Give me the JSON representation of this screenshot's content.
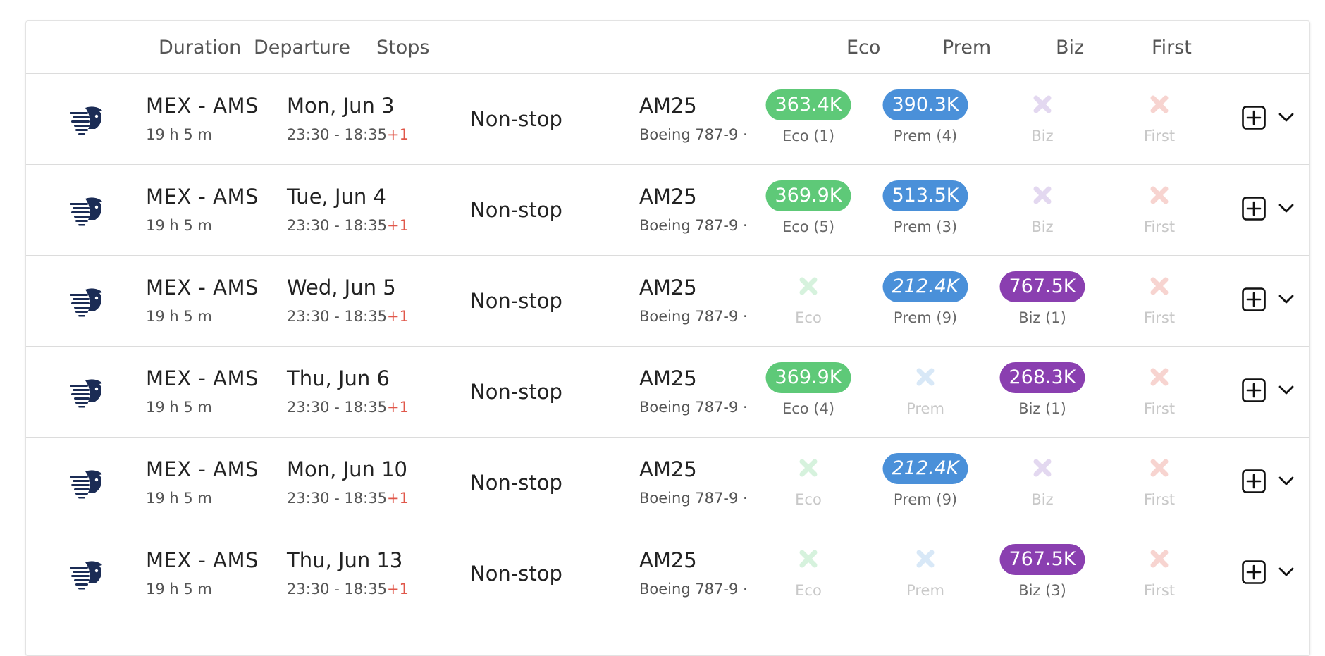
{
  "table": {
    "headers": {
      "duration": "Duration",
      "departure": "Departure",
      "stops": "Stops",
      "eco": "Eco",
      "prem": "Prem",
      "biz": "Biz",
      "first": "First"
    },
    "rows": [
      {
        "route": "MEX - AMS",
        "duration": "19 h 5 m",
        "date": "Mon, Jun 3",
        "times": "23:30 - 18:35",
        "day_offset": "+1",
        "stops": "Non-stop",
        "flight": "AM25",
        "aircraft": "Boeing 787-9 ·",
        "eco": {
          "available": true,
          "price": "363.4K",
          "label": "Eco (1)"
        },
        "prem": {
          "available": true,
          "price": "390.3K",
          "label": "Prem (4)"
        },
        "biz": {
          "available": false,
          "label": "Biz"
        },
        "first": {
          "available": false,
          "label": "First"
        }
      },
      {
        "route": "MEX - AMS",
        "duration": "19 h 5 m",
        "date": "Tue, Jun 4",
        "times": "23:30 - 18:35",
        "day_offset": "+1",
        "stops": "Non-stop",
        "flight": "AM25",
        "aircraft": "Boeing 787-9 ·",
        "eco": {
          "available": true,
          "price": "369.9K",
          "label": "Eco (5)"
        },
        "prem": {
          "available": true,
          "price": "513.5K",
          "label": "Prem (3)"
        },
        "biz": {
          "available": false,
          "label": "Biz"
        },
        "first": {
          "available": false,
          "label": "First"
        }
      },
      {
        "route": "MEX - AMS",
        "duration": "19 h 5 m",
        "date": "Wed, Jun 5",
        "times": "23:30 - 18:35",
        "day_offset": "+1",
        "stops": "Non-stop",
        "flight": "AM25",
        "aircraft": "Boeing 787-9 ·",
        "eco": {
          "available": false,
          "label": "Eco"
        },
        "prem": {
          "available": true,
          "price": "212.4K",
          "label": "Prem (9)",
          "italic": true
        },
        "biz": {
          "available": true,
          "price": "767.5K",
          "label": "Biz (1)"
        },
        "first": {
          "available": false,
          "label": "First"
        }
      },
      {
        "route": "MEX - AMS",
        "duration": "19 h 5 m",
        "date": "Thu, Jun 6",
        "times": "23:30 - 18:35",
        "day_offset": "+1",
        "stops": "Non-stop",
        "flight": "AM25",
        "aircraft": "Boeing 787-9 ·",
        "eco": {
          "available": true,
          "price": "369.9K",
          "label": "Eco (4)"
        },
        "prem": {
          "available": false,
          "label": "Prem"
        },
        "biz": {
          "available": true,
          "price": "268.3K",
          "label": "Biz (1)"
        },
        "first": {
          "available": false,
          "label": "First"
        }
      },
      {
        "route": "MEX - AMS",
        "duration": "19 h 5 m",
        "date": "Mon, Jun 10",
        "times": "23:30 - 18:35",
        "day_offset": "+1",
        "stops": "Non-stop",
        "flight": "AM25",
        "aircraft": "Boeing 787-9 ·",
        "eco": {
          "available": false,
          "label": "Eco"
        },
        "prem": {
          "available": true,
          "price": "212.4K",
          "label": "Prem (9)",
          "italic": true
        },
        "biz": {
          "available": false,
          "label": "Biz"
        },
        "first": {
          "available": false,
          "label": "First"
        }
      },
      {
        "route": "MEX - AMS",
        "duration": "19 h 5 m",
        "date": "Thu, Jun 13",
        "times": "23:30 - 18:35",
        "day_offset": "+1",
        "stops": "Non-stop",
        "flight": "AM25",
        "aircraft": "Boeing 787-9 ·",
        "eco": {
          "available": false,
          "label": "Eco"
        },
        "prem": {
          "available": false,
          "label": "Prem"
        },
        "biz": {
          "available": true,
          "price": "767.5K",
          "label": "Biz (3)"
        },
        "first": {
          "available": false,
          "label": "First"
        }
      }
    ]
  },
  "colors": {
    "eco": "#5ec978",
    "prem": "#4a90d9",
    "biz": "#8a3fb0",
    "first": "#e0574a",
    "eco_x": "#d6f2dd",
    "prem_x": "#d8e8f7",
    "biz_x": "#e3d8f0",
    "first_x": "#f7d4d0"
  }
}
